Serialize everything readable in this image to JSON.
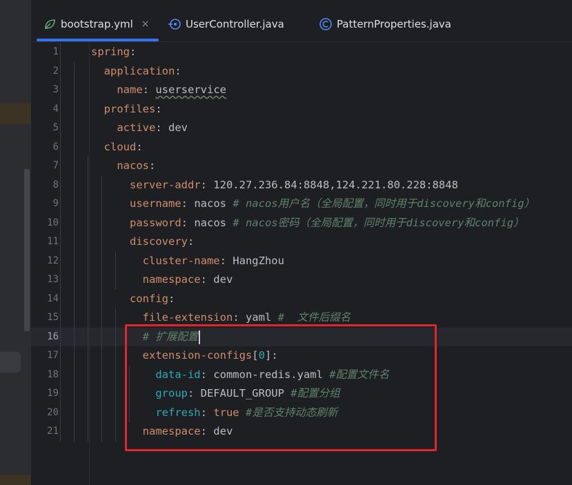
{
  "tabs": [
    {
      "label": "bootstrap.yml",
      "icon": "yaml-leaf-icon",
      "active": true,
      "closable": true
    },
    {
      "label": "UserController.java",
      "icon": "java-class-icon",
      "active": false
    },
    {
      "label": "PatternProperties.java",
      "icon": "config-class-icon",
      "active": false
    }
  ],
  "tab_close_glyph": "×",
  "editor": {
    "current_line": 16,
    "lines": [
      {
        "n": "1",
        "tokens": [
          {
            "t": "spring",
            "c": "k"
          },
          {
            "t": ":",
            "c": "v"
          }
        ]
      },
      {
        "n": "2",
        "tokens": [
          {
            "t": "  application",
            "c": "k"
          },
          {
            "t": ":",
            "c": "v"
          }
        ]
      },
      {
        "n": "3",
        "tokens": [
          {
            "t": "    name",
            "c": "k"
          },
          {
            "t": ": ",
            "c": "v"
          },
          {
            "t": "userservice",
            "c": "v u"
          }
        ]
      },
      {
        "n": "4",
        "tokens": [
          {
            "t": "  profiles",
            "c": "k"
          },
          {
            "t": ":",
            "c": "v"
          }
        ]
      },
      {
        "n": "5",
        "tokens": [
          {
            "t": "    active",
            "c": "k"
          },
          {
            "t": ": dev",
            "c": "v"
          }
        ]
      },
      {
        "n": "6",
        "tokens": [
          {
            "t": "  cloud",
            "c": "k"
          },
          {
            "t": ":",
            "c": "v"
          }
        ]
      },
      {
        "n": "7",
        "tokens": [
          {
            "t": "    nacos",
            "c": "k"
          },
          {
            "t": ":",
            "c": "v"
          }
        ]
      },
      {
        "n": "8",
        "tokens": [
          {
            "t": "      server-addr",
            "c": "k"
          },
          {
            "t": ": 120.27.236.84:8848,124.221.80.228:8848",
            "c": "v"
          }
        ]
      },
      {
        "n": "9",
        "tokens": [
          {
            "t": "      username",
            "c": "k"
          },
          {
            "t": ": nacos ",
            "c": "v"
          },
          {
            "t": "# nacos用户名（全局配置，同时用于discovery和config）",
            "c": "cz"
          }
        ]
      },
      {
        "n": "10",
        "tokens": [
          {
            "t": "      password",
            "c": "k"
          },
          {
            "t": ": nacos ",
            "c": "v"
          },
          {
            "t": "# nacos密码（全局配置，同时用于discovery和config）",
            "c": "cz"
          }
        ]
      },
      {
        "n": "11",
        "tokens": [
          {
            "t": "      discovery",
            "c": "k"
          },
          {
            "t": ":",
            "c": "v"
          }
        ]
      },
      {
        "n": "12",
        "tokens": [
          {
            "t": "        cluster-name",
            "c": "k"
          },
          {
            "t": ": HangZhou",
            "c": "v"
          }
        ]
      },
      {
        "n": "13",
        "tokens": [
          {
            "t": "        namespace",
            "c": "k"
          },
          {
            "t": ": dev",
            "c": "v"
          }
        ]
      },
      {
        "n": "14",
        "tokens": [
          {
            "t": "      config",
            "c": "k"
          },
          {
            "t": ":",
            "c": "v"
          }
        ]
      },
      {
        "n": "15",
        "tokens": [
          {
            "t": "        file-extension",
            "c": "k"
          },
          {
            "t": ": yaml ",
            "c": "v"
          },
          {
            "t": "#  文件后缀名",
            "c": "cz"
          }
        ]
      },
      {
        "n": "16",
        "tokens": [
          {
            "t": "        # 扩展配置",
            "c": "cz"
          }
        ]
      },
      {
        "n": "17",
        "tokens": [
          {
            "t": "        extension-configs",
            "c": "k"
          },
          {
            "t": "[",
            "c": "v"
          },
          {
            "t": "0",
            "c": "n"
          },
          {
            "t": "]:",
            "c": "v"
          }
        ]
      },
      {
        "n": "18",
        "tokens": [
          {
            "t": "          data-id",
            "c": "n"
          },
          {
            "t": ": common-redis.yaml ",
            "c": "v"
          },
          {
            "t": "#配置文件名",
            "c": "cz"
          }
        ]
      },
      {
        "n": "19",
        "tokens": [
          {
            "t": "          group",
            "c": "n"
          },
          {
            "t": ": DEFAULT_GROUP ",
            "c": "v"
          },
          {
            "t": "#配置分组",
            "c": "cz"
          }
        ]
      },
      {
        "n": "20",
        "tokens": [
          {
            "t": "          refresh",
            "c": "n"
          },
          {
            "t": ": ",
            "c": "v"
          },
          {
            "t": "true",
            "c": "k"
          },
          {
            "t": " ",
            "c": "v"
          },
          {
            "t": "#是否支持动态刷新",
            "c": "cz"
          }
        ]
      },
      {
        "n": "21",
        "tokens": [
          {
            "t": "        namespace",
            "c": "k"
          },
          {
            "t": ": dev",
            "c": "v"
          }
        ]
      }
    ]
  },
  "annotation": {
    "color": "#e3262e",
    "label": "highlight-box"
  }
}
